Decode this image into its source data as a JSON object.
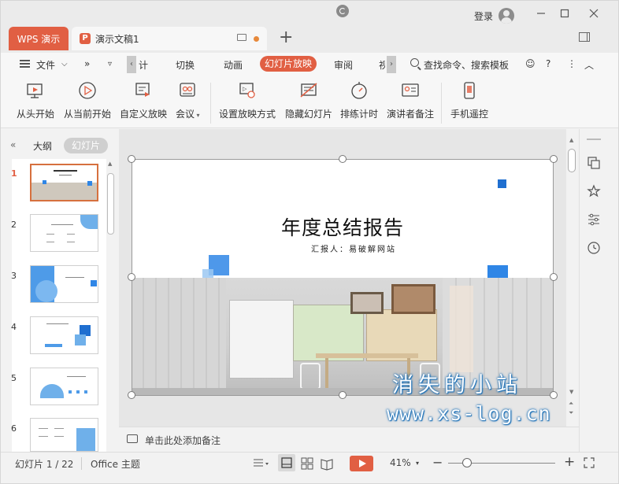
{
  "titlebar": {
    "app_tab": "WPS 演示",
    "doc_tab": "演示文稿1",
    "new_tab": "+",
    "login": "登录"
  },
  "menu": {
    "file": "文件",
    "more": "»",
    "tabs": [
      "计",
      "切换",
      "动画",
      "幻灯片放映",
      "审阅",
      "视"
    ],
    "search": "查找命令、搜索模板"
  },
  "ribbon": {
    "buttons": [
      "从头开始",
      "从当前开始",
      "自定义放映",
      "会议",
      "设置放映方式",
      "隐藏幻灯片",
      "排练计时",
      "演讲者备注",
      "手机遥控"
    ]
  },
  "leftpane": {
    "collapse": "«",
    "tab_outline": "大纲",
    "tab_slides": "幻灯片",
    "slide_numbers": [
      "1",
      "2",
      "3",
      "4",
      "5",
      "6"
    ]
  },
  "slide": {
    "title": "年度总结报告",
    "subtitle": "汇报人：易破解网站"
  },
  "notes": {
    "placeholder": "单击此处添加备注"
  },
  "status": {
    "slide_info": "幻灯片 1 / 22",
    "theme": "Office 主题",
    "zoom": "41%",
    "minus": "−",
    "plus": "+"
  },
  "watermark": {
    "line1": "消失的小站",
    "line2": "www.xs-log.cn"
  },
  "colors": {
    "accent": "#e15f43",
    "blue": "#2f86e6",
    "watermark_glow": "#1b6fb6"
  }
}
